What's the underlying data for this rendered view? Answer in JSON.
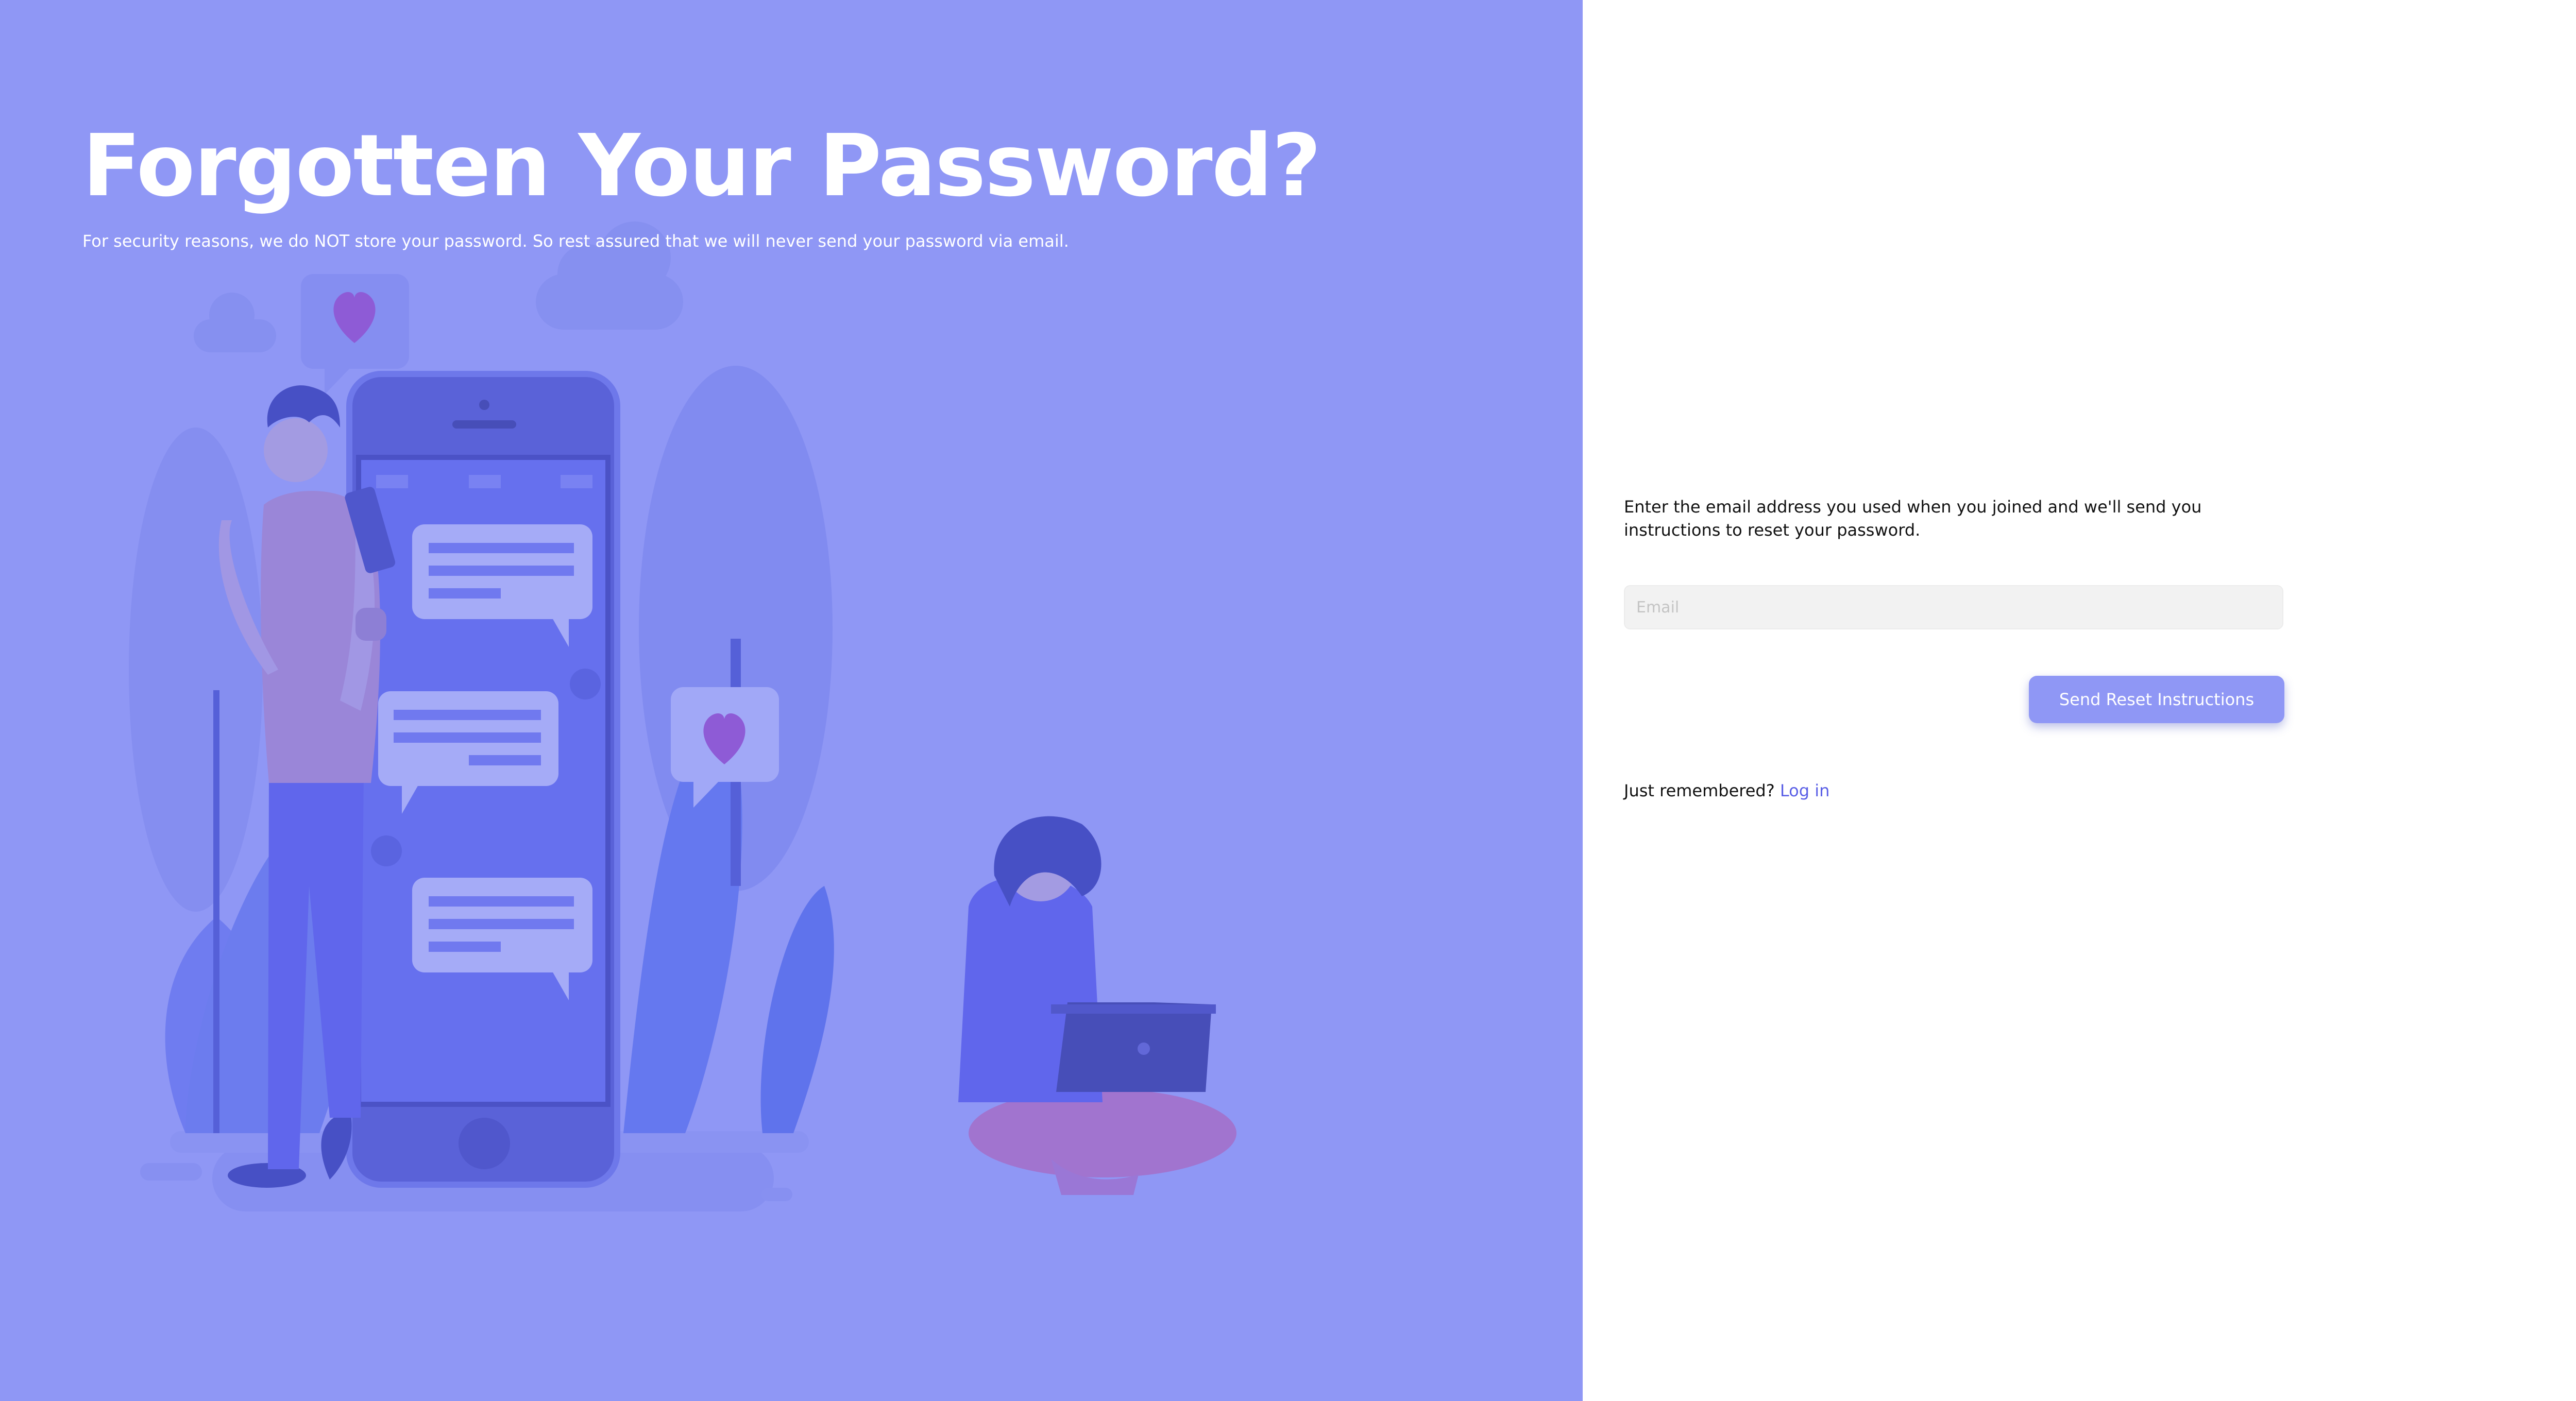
{
  "hero": {
    "title": "Forgotten Your Password?",
    "subtitle": "For security reasons, we do NOT store your password. So rest assured that we will never send your password via email."
  },
  "form": {
    "instructions": "Enter the email address you used when you joined and we'll send you instructions to reset your password.",
    "email_placeholder": "Email",
    "email_value": "",
    "submit_label": "Send Reset Instructions",
    "remember_text": "Just remembered?",
    "login_label": "Log in"
  },
  "colors": {
    "hero_background": "#8f97f5",
    "button_background": "#8f97f5",
    "link": "#5a5fe6",
    "input_background": "#f2f2f2"
  },
  "icons": [
    "heart-icon",
    "phone-illustration",
    "chat-bubble-icon",
    "cloud-icon",
    "laptop-icon"
  ]
}
